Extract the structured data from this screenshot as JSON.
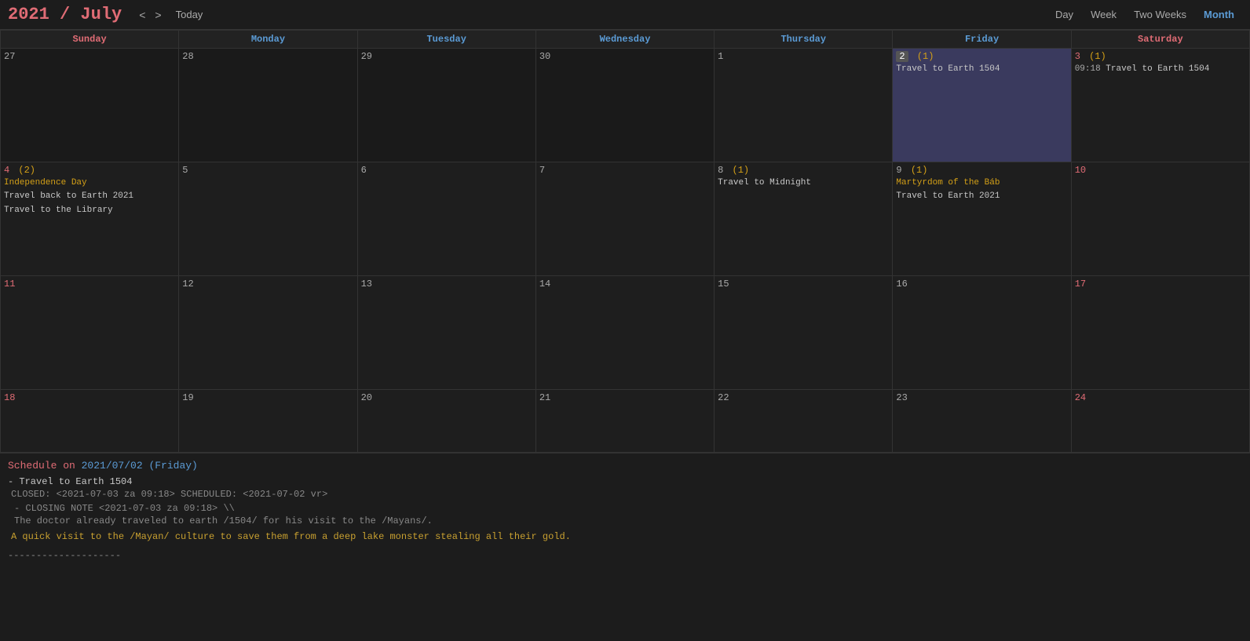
{
  "header": {
    "year": "2021",
    "slash": " / ",
    "month": "July",
    "prev_label": "<",
    "next_label": ">",
    "today_label": "Today",
    "views": [
      "Day",
      "Week",
      "Two Weeks",
      "Month"
    ],
    "active_view": "Month"
  },
  "day_headers": [
    {
      "label": "Sunday",
      "class": "sunday"
    },
    {
      "label": "Monday",
      "class": "weekday"
    },
    {
      "label": "Tuesday",
      "class": "weekday"
    },
    {
      "label": "Wednesday",
      "class": "weekday"
    },
    {
      "label": "Thursday",
      "class": "weekday"
    },
    {
      "label": "Friday",
      "class": "weekday"
    },
    {
      "label": "Saturday",
      "class": "saturday"
    }
  ],
  "weeks": [
    {
      "days": [
        {
          "num": "27",
          "type": "other",
          "events": []
        },
        {
          "num": "28",
          "type": "other",
          "events": []
        },
        {
          "num": "29",
          "type": "other",
          "events": []
        },
        {
          "num": "30",
          "type": "other",
          "events": []
        },
        {
          "num": "1",
          "type": "normal",
          "events": []
        },
        {
          "num": "2",
          "count": "(1)",
          "type": "highlight",
          "events": [
            {
              "text": "Travel to Earth 1504",
              "class": "normal"
            }
          ]
        },
        {
          "num": "3",
          "count": "(1)",
          "type": "saturday",
          "events": [
            {
              "time": "09:18",
              "text": "Travel to Earth 1504",
              "class": "normal"
            }
          ]
        }
      ]
    },
    {
      "days": [
        {
          "num": "4",
          "count": "(2)",
          "type": "sunday",
          "events": [
            {
              "text": "Independence Day",
              "class": "holiday"
            },
            {
              "text": "Travel back to Earth 2021",
              "class": "normal"
            },
            {
              "text": "Travel to the Library",
              "class": "normal"
            }
          ]
        },
        {
          "num": "5",
          "type": "normal",
          "events": []
        },
        {
          "num": "6",
          "type": "normal",
          "events": []
        },
        {
          "num": "7",
          "type": "normal",
          "events": []
        },
        {
          "num": "8",
          "count": "(1)",
          "type": "normal",
          "events": [
            {
              "text": "Travel to Midnight",
              "class": "normal"
            }
          ]
        },
        {
          "num": "9",
          "count": "(1)",
          "type": "normal",
          "events": [
            {
              "text": "Martyrdom of the Báb",
              "class": "holiday"
            },
            {
              "text": "Travel to Earth 2021",
              "class": "normal"
            }
          ]
        },
        {
          "num": "10",
          "type": "saturday",
          "events": []
        }
      ]
    },
    {
      "days": [
        {
          "num": "11",
          "type": "sunday",
          "events": []
        },
        {
          "num": "12",
          "type": "normal",
          "events": []
        },
        {
          "num": "13",
          "type": "normal",
          "events": []
        },
        {
          "num": "14",
          "type": "normal",
          "events": []
        },
        {
          "num": "15",
          "type": "normal",
          "events": []
        },
        {
          "num": "16",
          "type": "normal",
          "events": []
        },
        {
          "num": "17",
          "type": "saturday",
          "events": []
        }
      ]
    },
    {
      "days": [
        {
          "num": "18",
          "type": "sunday",
          "events": []
        },
        {
          "num": "19",
          "type": "normal",
          "events": []
        },
        {
          "num": "20",
          "type": "normal",
          "events": []
        },
        {
          "num": "21",
          "type": "normal",
          "events": []
        },
        {
          "num": "22",
          "type": "normal",
          "events": []
        },
        {
          "num": "23",
          "type": "normal",
          "events": []
        },
        {
          "num": "24",
          "type": "saturday",
          "events": []
        }
      ]
    }
  ],
  "schedule": {
    "title": "Schedule on 2021/07/02 (Friday)",
    "title_highlight": "2021/07/02 (Friday)",
    "items": [
      {
        "dash": "-",
        "title": "Travel to Earth 1504",
        "meta": "CLOSED: <2021-07-03 za 09:18> SCHEDULED: <2021-07-02 vr>",
        "closing_note": "- CLOSING NOTE <2021-07-03 za 09:18> \\\\",
        "closing_line": "The doctor already traveled to earth /1504/ for his visit to the /Mayans/.",
        "note": "A quick visit to the /Mayan/ culture to save them from a deep lake monster stealing all their gold."
      }
    ],
    "divider": "--------------------"
  }
}
